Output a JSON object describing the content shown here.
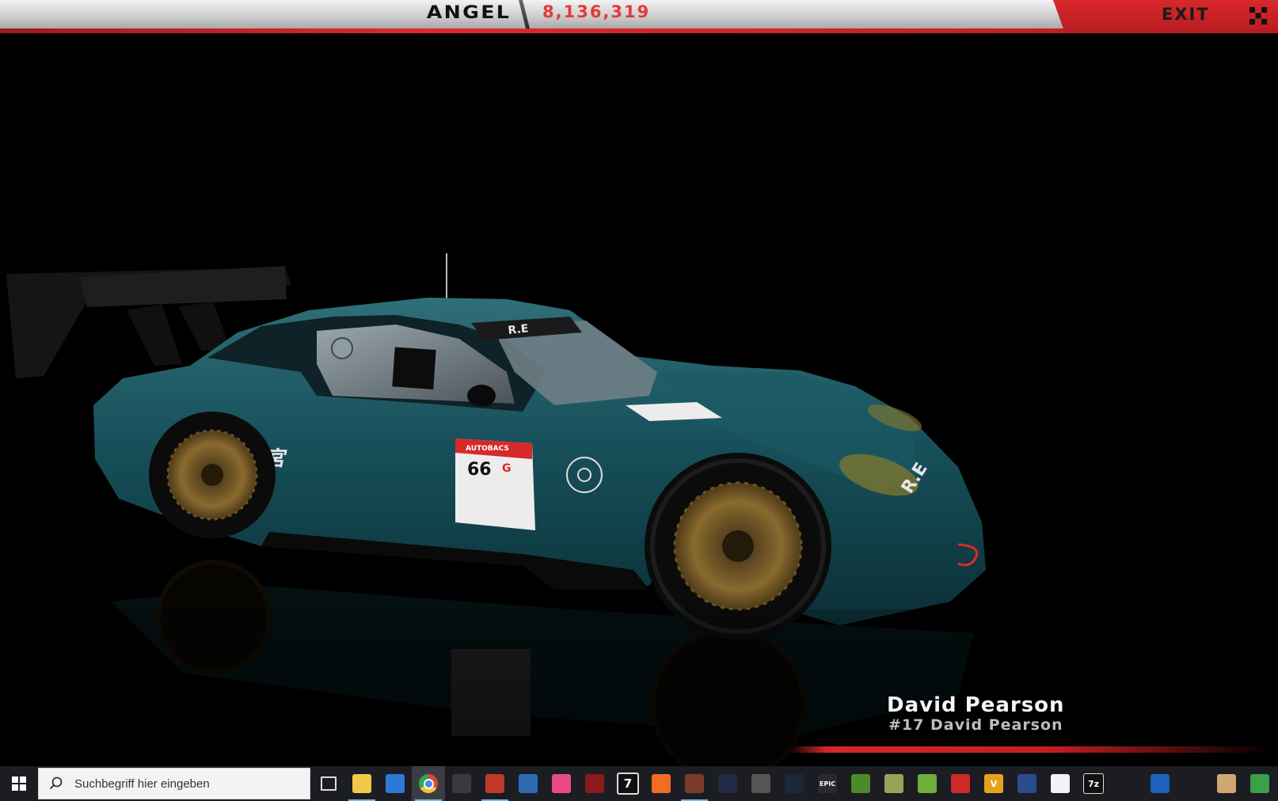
{
  "game": {
    "player_name": "ANGEL",
    "credits": "8,136,319",
    "exit_label": "EXIT",
    "colors": {
      "accent_red": "#d9282c",
      "credits_red": "#e33a3a"
    }
  },
  "car": {
    "livery_text": "R.E雨宮",
    "race_number": "66",
    "sponsor_text": "AUTOBACS"
  },
  "driver": {
    "name": "David Pearson",
    "subtitle": "#17 David Pearson"
  },
  "taskbar": {
    "search_placeholder": "Suchbegriff hier eingeben",
    "apps": [
      {
        "name": "task-view",
        "label": "",
        "color": "#1b1d22"
      },
      {
        "name": "file-explorer",
        "label": "",
        "color": "#f2c84b"
      },
      {
        "name": "microsoft-store",
        "label": "",
        "color": "#2d7ad6"
      },
      {
        "name": "chrome",
        "label": "",
        "color": "#2fa84f"
      },
      {
        "name": "calculator",
        "label": "",
        "color": "#3a3a3a"
      },
      {
        "name": "app-red-swirl",
        "label": "",
        "color": "#c0392b"
      },
      {
        "name": "app-blue-disc",
        "label": "",
        "color": "#2b6cb0"
      },
      {
        "name": "forza",
        "label": "",
        "color": "#e84a8a"
      },
      {
        "name": "app-gear-red",
        "label": "",
        "color": "#8b1a1a"
      },
      {
        "name": "app-seven",
        "label": "7",
        "color": "#111111"
      },
      {
        "name": "origin",
        "label": "",
        "color": "#f26c22"
      },
      {
        "name": "app-game-portrait",
        "label": "",
        "color": "#7a3b2e"
      },
      {
        "name": "uplay",
        "label": "",
        "color": "#222a44"
      },
      {
        "name": "app-car-thumb",
        "label": "",
        "color": "#555555"
      },
      {
        "name": "steam",
        "label": "",
        "color": "#1b2838"
      },
      {
        "name": "epic-games",
        "label": "EPIC",
        "color": "#2a2a2a"
      },
      {
        "name": "app-green-game",
        "label": "",
        "color": "#4c8a2a"
      },
      {
        "name": "app-game-pv2",
        "label": "",
        "color": "#9aa15a"
      },
      {
        "name": "app-green-char",
        "label": "",
        "color": "#6fae3a"
      },
      {
        "name": "app-red-square",
        "label": "",
        "color": "#cc2a2a"
      },
      {
        "name": "app-v-orange",
        "label": "V",
        "color": "#e6a21a"
      },
      {
        "name": "app-blue-figure",
        "label": "",
        "color": "#2a4d8f"
      },
      {
        "name": "itunes",
        "label": "",
        "color": "#f3f3f3"
      },
      {
        "name": "7zip",
        "label": "7z",
        "color": "#111111"
      },
      {
        "name": "app-clock",
        "label": "",
        "color": "#1b1d22"
      },
      {
        "name": "app-controller",
        "label": "",
        "color": "#1f5fbf"
      },
      {
        "name": "app-chart",
        "label": "",
        "color": "#1b1d22"
      },
      {
        "name": "paint",
        "label": "",
        "color": "#cfa870"
      },
      {
        "name": "app-last",
        "label": "",
        "color": "#3aa04a"
      }
    ]
  }
}
